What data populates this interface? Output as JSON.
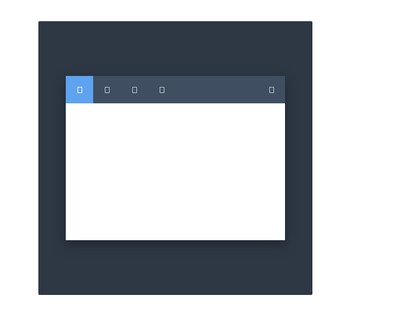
{
  "toolbar": {
    "buttons": [
      {
        "icon": "tab-1-icon",
        "active": true
      },
      {
        "icon": "tab-2-icon",
        "active": false
      },
      {
        "icon": "tab-3-icon",
        "active": false
      },
      {
        "icon": "tab-4-icon",
        "active": false
      }
    ],
    "right_button": {
      "icon": "menu-icon"
    }
  },
  "colors": {
    "stage_bg": "#2e3845",
    "toolbar_bg": "#3f4f61",
    "active_bg": "#5ea3ef",
    "content_bg": "#ffffff"
  }
}
